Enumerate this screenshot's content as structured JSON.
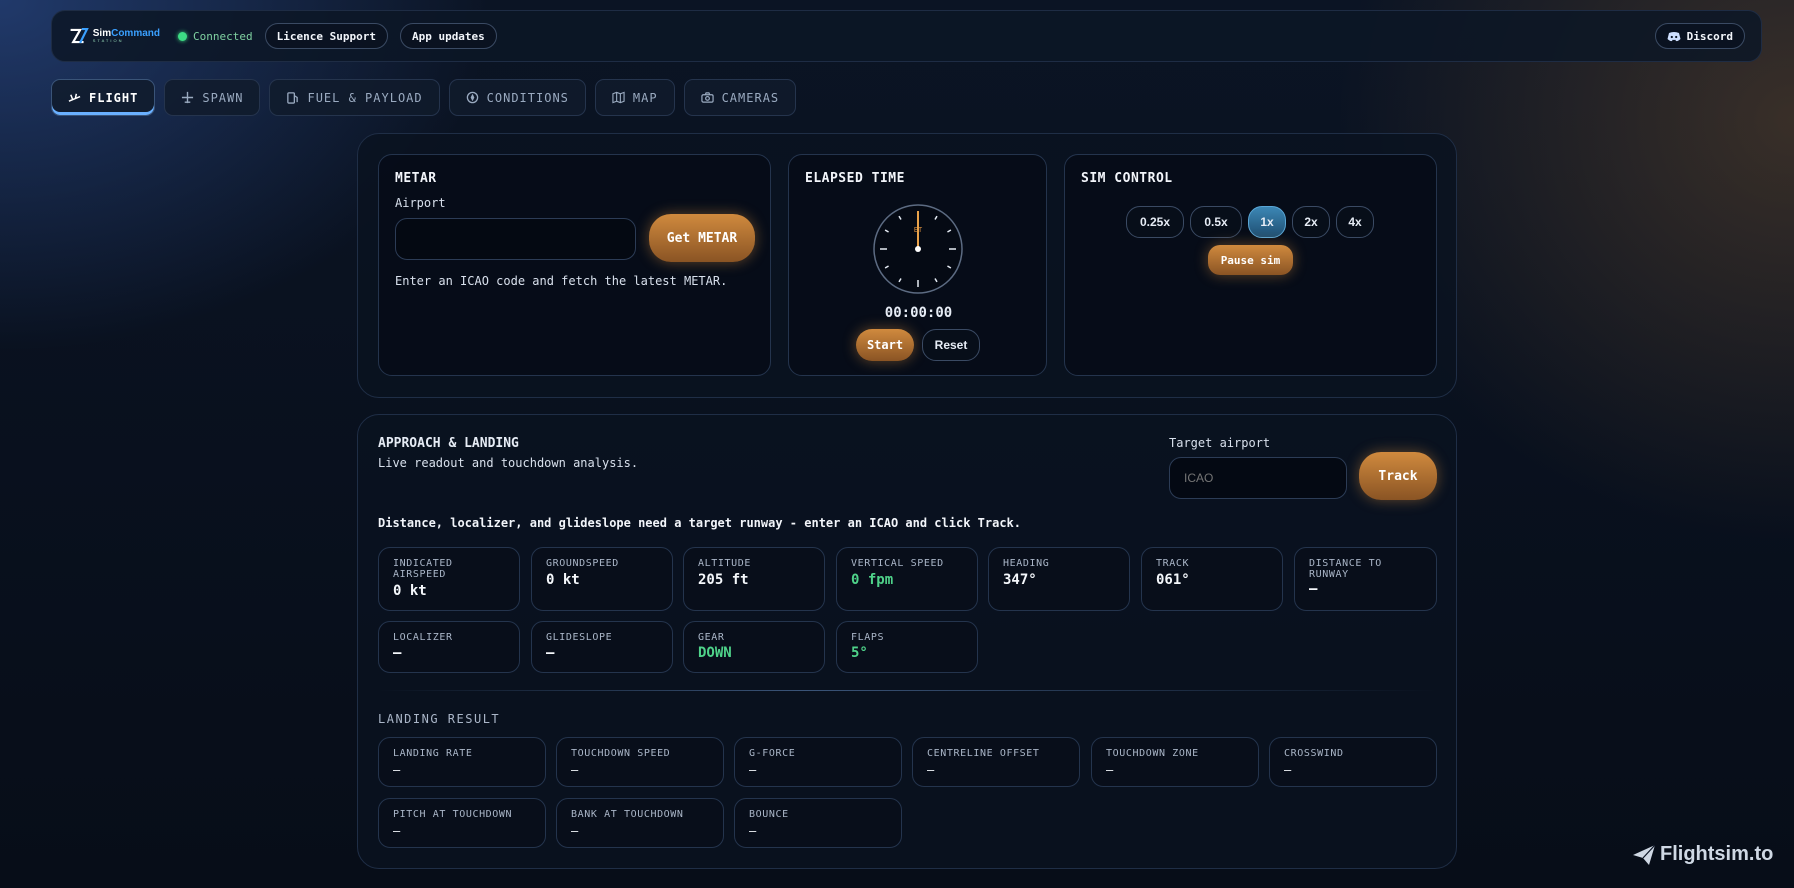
{
  "header": {
    "logo_line1_a": "Sim",
    "logo_line1_b": "Command",
    "logo_line2": "STATION",
    "status": "Connected",
    "licence_btn": "Licence Support",
    "updates_btn": "App updates",
    "discord_btn": "Discord"
  },
  "tabs": [
    {
      "label": "FLIGHT",
      "icon": "plane-takeoff-icon",
      "active": true
    },
    {
      "label": "SPAWN",
      "icon": "plane-icon"
    },
    {
      "label": "FUEL & PAYLOAD",
      "icon": "fuel-icon"
    },
    {
      "label": "CONDITIONS",
      "icon": "compass-icon"
    },
    {
      "label": "MAP",
      "icon": "map-icon"
    },
    {
      "label": "CAMERAS",
      "icon": "camera-icon"
    }
  ],
  "metar": {
    "title": "METAR",
    "airport_label": "Airport",
    "airport_value": "",
    "button": "Get METAR",
    "hint": "Enter an ICAO code and fetch the latest METAR."
  },
  "elapsed": {
    "title": "ELAPSED TIME",
    "dial_label": "ET",
    "time": "00:00:00",
    "start": "Start",
    "reset": "Reset"
  },
  "sim_control": {
    "title": "SIM CONTROL",
    "speeds": [
      "0.25x",
      "0.5x",
      "1x",
      "2x",
      "4x"
    ],
    "active_speed": "1x",
    "pause": "Pause sim"
  },
  "approach": {
    "title": "APPROACH & LANDING",
    "subtitle": "Live readout and touchdown analysis.",
    "target_label": "Target airport",
    "target_placeholder": "ICAO",
    "track_btn": "Track",
    "notice": "Distance, localizer, and glideslope need a target runway - enter an ICAO and click Track.",
    "readouts": [
      {
        "label": "INDICATED AIRSPEED",
        "value": "0 kt"
      },
      {
        "label": "GROUNDSPEED",
        "value": "0 kt"
      },
      {
        "label": "ALTITUDE",
        "value": "205 ft"
      },
      {
        "label": "VERTICAL SPEED",
        "value": "0 fpm",
        "color": "#4fd38a"
      },
      {
        "label": "HEADING",
        "value": "347°"
      },
      {
        "label": "TRACK",
        "value": "061°"
      },
      {
        "label": "DISTANCE TO RUNWAY",
        "value": "—"
      },
      {
        "label": "LOCALIZER",
        "value": "—"
      },
      {
        "label": "GLIDESLOPE",
        "value": "—"
      },
      {
        "label": "GEAR",
        "value": "DOWN",
        "color": "#4fd38a"
      },
      {
        "label": "FLAPS",
        "value": "5°",
        "color": "#4fd38a"
      }
    ],
    "landing_title": "LANDING RESULT",
    "landing": [
      {
        "label": "LANDING RATE",
        "value": "—"
      },
      {
        "label": "TOUCHDOWN SPEED",
        "value": "—"
      },
      {
        "label": "G-FORCE",
        "value": "—"
      },
      {
        "label": "CENTRELINE OFFSET",
        "value": "—"
      },
      {
        "label": "TOUCHDOWN ZONE",
        "value": "—"
      },
      {
        "label": "CROSSWIND",
        "value": "—"
      },
      {
        "label": "PITCH AT TOUCHDOWN",
        "value": "—"
      },
      {
        "label": "BANK AT TOUCHDOWN",
        "value": "—"
      },
      {
        "label": "BOUNCE",
        "value": "—"
      }
    ]
  },
  "watermark": "Flightsim.to",
  "colors": {
    "accent_orange": "#d08a3e",
    "accent_green": "#4fd38a",
    "accent_blue": "#3c87b5"
  }
}
